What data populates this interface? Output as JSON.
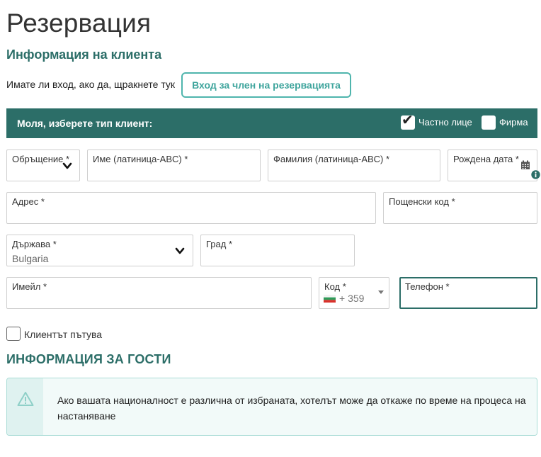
{
  "page": {
    "title": "Резервация",
    "section_title": "Информация на клиента"
  },
  "login": {
    "prompt": "Имате ли вход, ако да, щракнете тук",
    "button_label": "Вход за член на резервацията"
  },
  "client_type": {
    "label": "Моля, изберете тип клиент:",
    "options": [
      {
        "label": "Частно лице",
        "checked": true
      },
      {
        "label": "Фирма",
        "checked": false
      }
    ]
  },
  "form": {
    "salutation_label": "Обръщение *",
    "first_name_label": "Име (латиница-ABC) *",
    "last_name_label": "Фамилия (латиница-ABC) *",
    "birth_date_label": "Рождена дата *",
    "address_label": "Адрес *",
    "postal_code_label": "Пощенски код *",
    "country_label": "Държава *",
    "country_value": "Bulgaria",
    "city_label": "Град *",
    "email_label": "Имейл *",
    "phone_code_label": "Код *",
    "phone_code_value": "+ 359",
    "phone_label": "Телефон *"
  },
  "traveler": {
    "label": "Клиентът пътува",
    "checked": false
  },
  "guests": {
    "title": "ИНФОРМАЦИЯ ЗА ГОСТИ"
  },
  "alert": {
    "icon": "warning-icon",
    "text": "Ако вашата националност е различна от избраната, хотелът може да откаже по време на процеса на настаняване"
  },
  "colors": {
    "brand": "#2c6e68",
    "accent": "#4fb5ad",
    "alert_bg": "#eef8f7"
  }
}
